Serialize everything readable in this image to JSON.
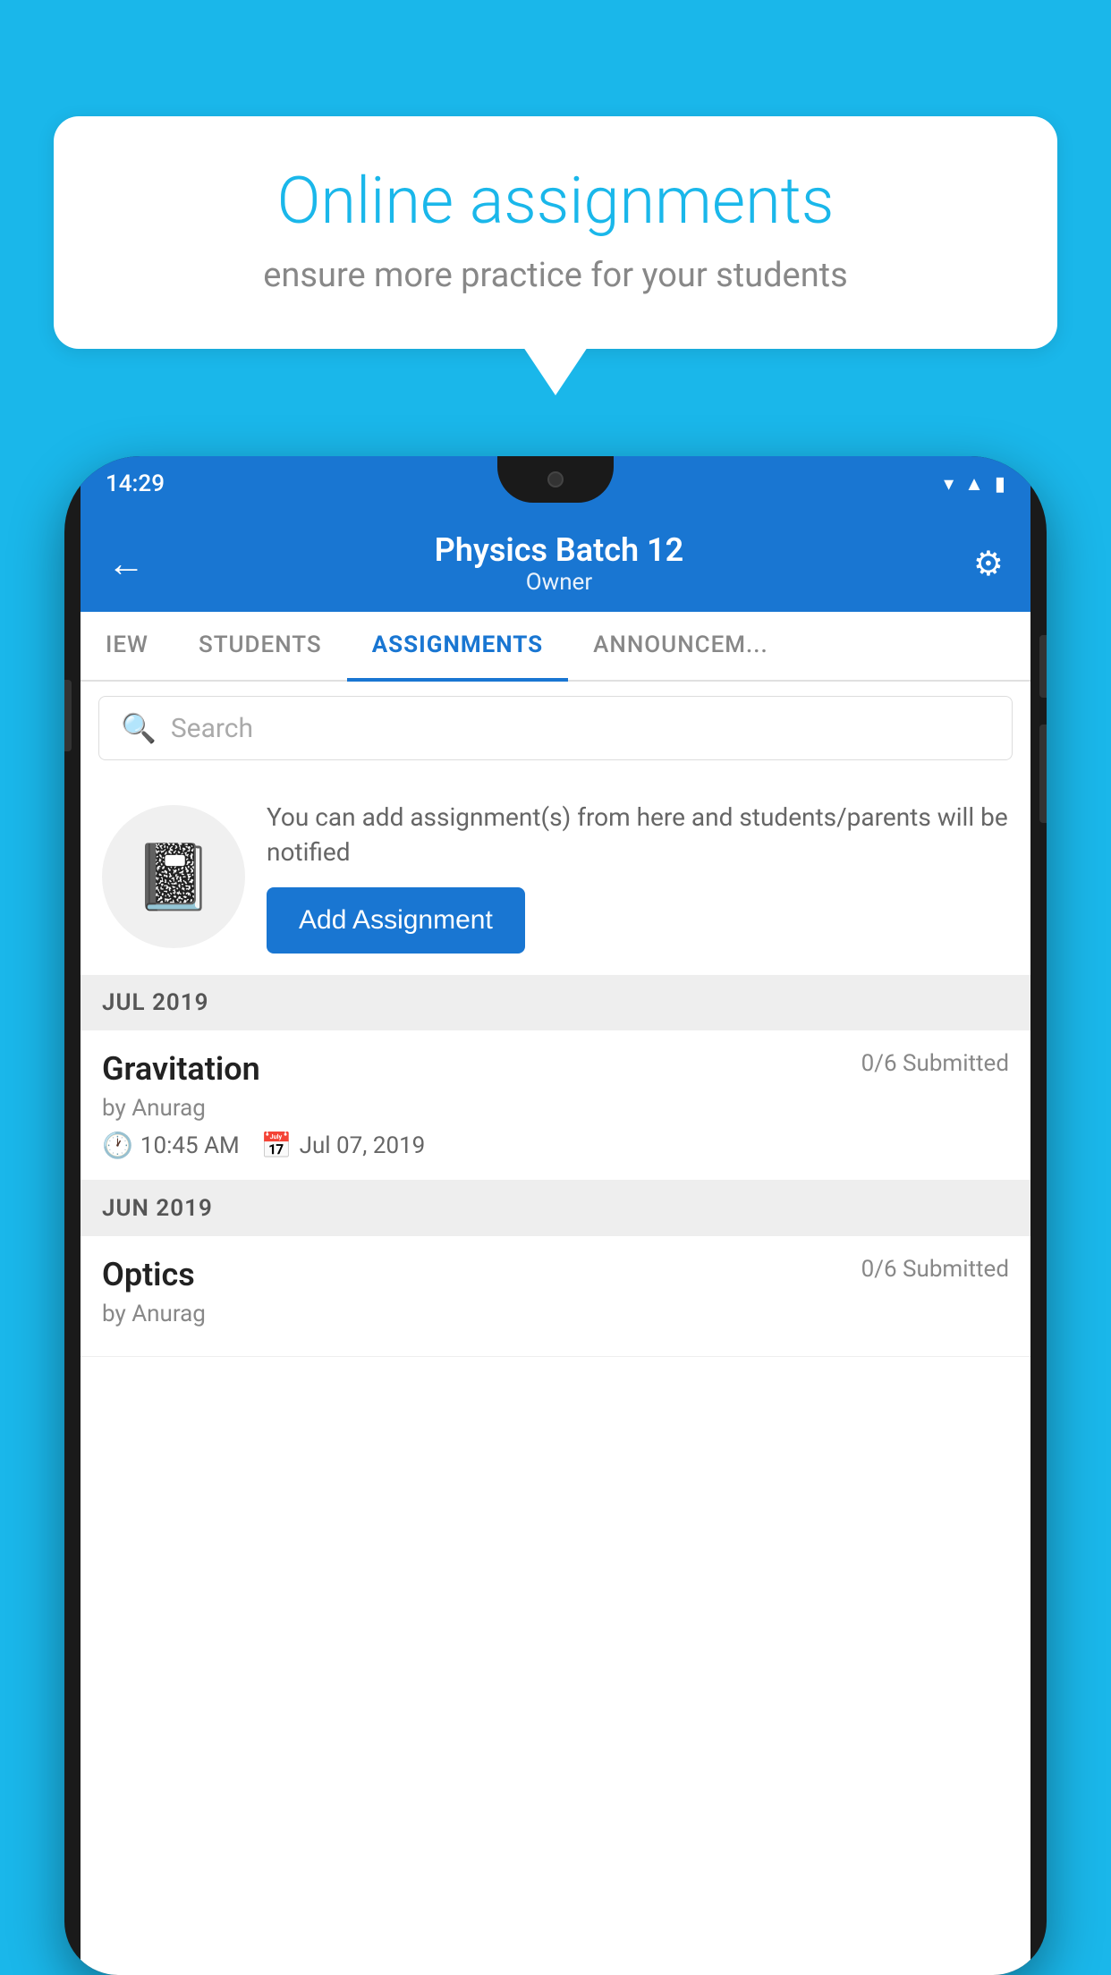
{
  "background_color": "#1ab7ea",
  "speech_bubble": {
    "title": "Online assignments",
    "subtitle": "ensure more practice for your students"
  },
  "phone": {
    "status_bar": {
      "time": "14:29",
      "icons": [
        "wifi",
        "signal",
        "battery"
      ]
    },
    "header": {
      "title": "Physics Batch 12",
      "subtitle": "Owner",
      "back_label": "←",
      "settings_label": "⚙"
    },
    "tabs": [
      {
        "label": "IEW",
        "active": false
      },
      {
        "label": "STUDENTS",
        "active": false
      },
      {
        "label": "ASSIGNMENTS",
        "active": true
      },
      {
        "label": "ANNOUNCEM...",
        "active": false
      }
    ],
    "search": {
      "placeholder": "Search"
    },
    "promo": {
      "description": "You can add assignment(s) from here and students/parents will be notified",
      "button_label": "Add Assignment"
    },
    "sections": [
      {
        "month": "JUL 2019",
        "assignments": [
          {
            "name": "Gravitation",
            "submitted": "0/6 Submitted",
            "author": "by Anurag",
            "time": "10:45 AM",
            "date": "Jul 07, 2019"
          }
        ]
      },
      {
        "month": "JUN 2019",
        "assignments": [
          {
            "name": "Optics",
            "submitted": "0/6 Submitted",
            "author": "by Anurag",
            "time": "",
            "date": ""
          }
        ]
      }
    ]
  }
}
